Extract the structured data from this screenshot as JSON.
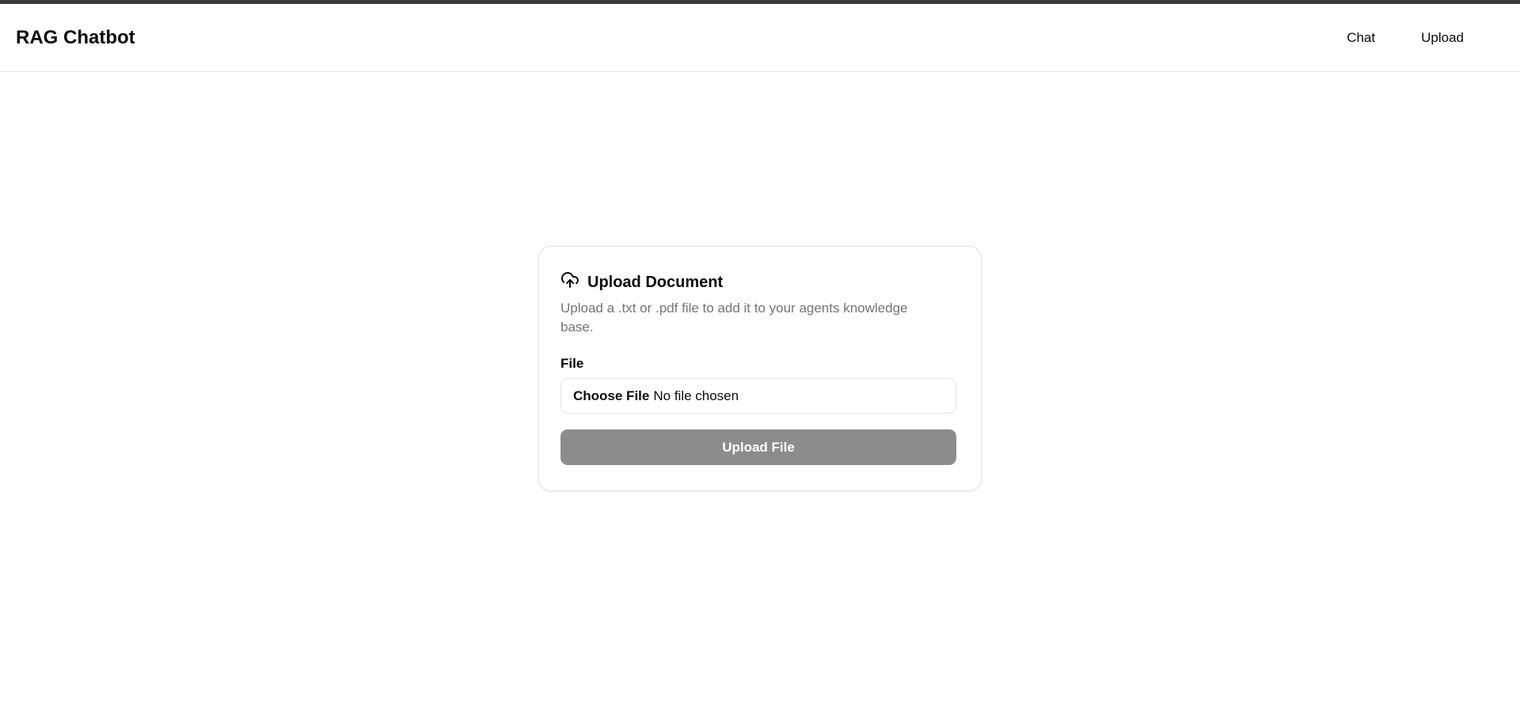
{
  "header": {
    "title": "RAG Chatbot",
    "nav": [
      {
        "label": "Chat"
      },
      {
        "label": "Upload"
      }
    ]
  },
  "card": {
    "icon": "cloud-upload-icon",
    "title": "Upload Document",
    "description": "Upload a .txt or .pdf file to add it to your agents knowledge base.",
    "file_label": "File",
    "choose_file": "Choose File",
    "no_file": "No file chosen",
    "submit": "Upload File"
  },
  "colors": {
    "button_disabled": "#8c8c8c",
    "muted_text": "#737373",
    "topbar": "#3a3a3a"
  }
}
